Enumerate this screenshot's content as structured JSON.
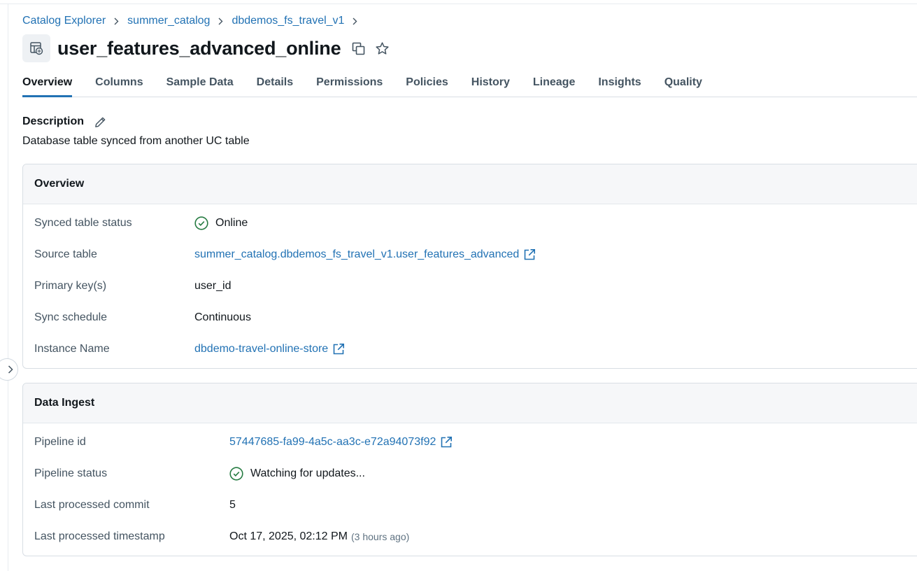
{
  "breadcrumb": {
    "items": [
      "Catalog Explorer",
      "summer_catalog",
      "dbdemos_fs_travel_v1"
    ]
  },
  "page": {
    "title": "user_features_advanced_online",
    "icon": "table-sync-icon"
  },
  "tabs": [
    {
      "label": "Overview",
      "active": true
    },
    {
      "label": "Columns",
      "active": false
    },
    {
      "label": "Sample Data",
      "active": false
    },
    {
      "label": "Details",
      "active": false
    },
    {
      "label": "Permissions",
      "active": false
    },
    {
      "label": "Policies",
      "active": false
    },
    {
      "label": "History",
      "active": false
    },
    {
      "label": "Lineage",
      "active": false
    },
    {
      "label": "Insights",
      "active": false
    },
    {
      "label": "Quality",
      "active": false
    }
  ],
  "description": {
    "label": "Description",
    "text": "Database table synced from another UC table"
  },
  "overview_card": {
    "title": "Overview",
    "rows": [
      {
        "label": "Synced table status",
        "value": "Online",
        "status": "success"
      },
      {
        "label": "Source table",
        "value": "summer_catalog.dbdemos_fs_travel_v1.user_features_advanced",
        "link": true
      },
      {
        "label": "Primary key(s)",
        "value": "user_id"
      },
      {
        "label": "Sync schedule",
        "value": "Continuous"
      },
      {
        "label": "Instance Name",
        "value": "dbdemo-travel-online-store",
        "link": true
      }
    ]
  },
  "ingest_card": {
    "title": "Data Ingest",
    "rows": [
      {
        "label": "Pipeline id",
        "value": "57447685-fa99-4a5c-aa3c-e72a94073f92",
        "link": true
      },
      {
        "label": "Pipeline status",
        "value": "Watching for updates...",
        "status": "success"
      },
      {
        "label": "Last processed commit",
        "value": "5"
      },
      {
        "label": "Last processed timestamp",
        "value": "Oct 17, 2025, 02:12 PM",
        "relative": "(3 hours ago)"
      }
    ]
  },
  "colors": {
    "link": "#2272b4",
    "success": "#277c43",
    "active_tab_underline": "#2272b4"
  }
}
